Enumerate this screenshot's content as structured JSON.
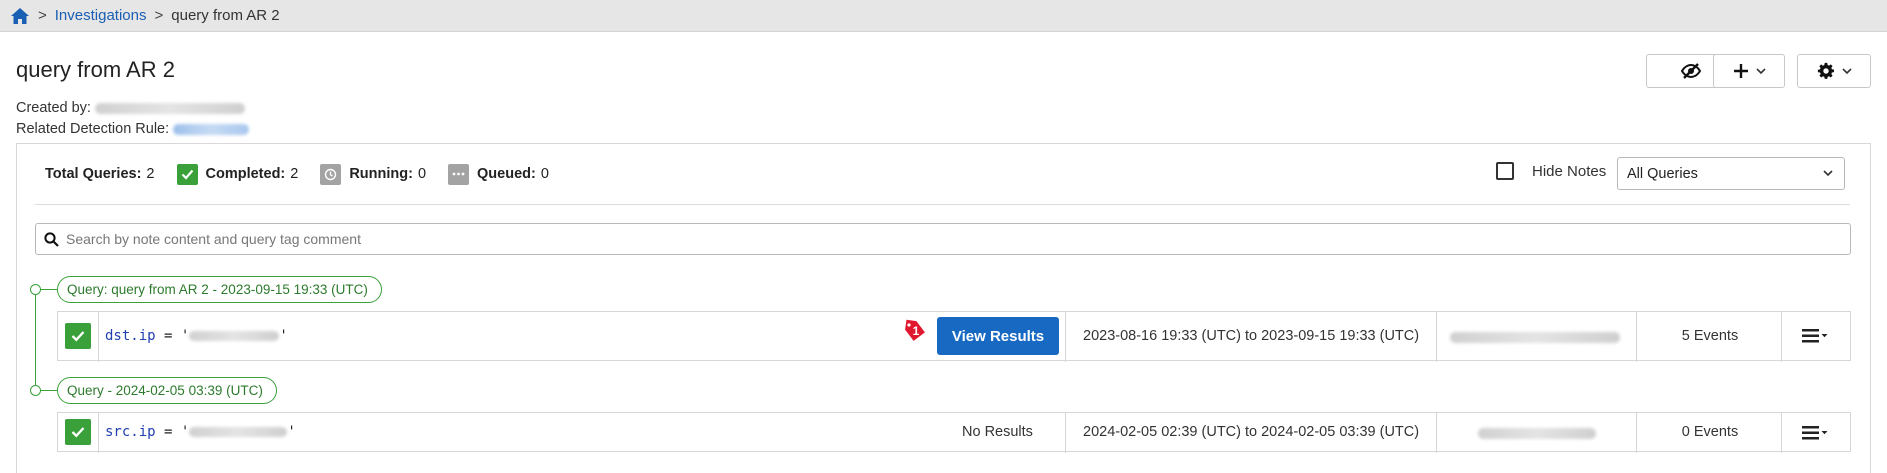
{
  "breadcrumb": {
    "home_icon": "home-icon",
    "separator": ">",
    "items": [
      {
        "label": "Investigations",
        "link": true
      },
      {
        "label": "query from AR 2",
        "link": false
      }
    ]
  },
  "header": {
    "title": "query from AR 2",
    "created_by_label": "Created by:",
    "related_rule_label": "Related Detection Rule:",
    "toolbar": {
      "hide_icon": "eye-slash-icon",
      "add_icon": "plus-icon",
      "settings_icon": "gear-icon"
    }
  },
  "stats": {
    "total_label": "Total Queries:",
    "total_value": "2",
    "completed_label": "Completed:",
    "completed_value": "2",
    "running_label": "Running:",
    "running_value": "0",
    "queued_label": "Queued:",
    "queued_value": "0"
  },
  "filters": {
    "hide_notes_label": "Hide Notes",
    "hide_notes_checked": false,
    "query_filter_value": "All Queries"
  },
  "search": {
    "placeholder": "Search by note content and query tag comment"
  },
  "queries": [
    {
      "label": "Query: query from AR 2 - 2023-09-15 19:33 (UTC)",
      "field": "dst.ip",
      "operator": "= '",
      "closing_quote": "'",
      "notification_count": "1",
      "action_label": "View Results",
      "range": "2023-08-16 19:33 (UTC) to 2023-09-15 19:33 (UTC)",
      "events": "5 Events"
    },
    {
      "label": "Query - 2024-02-05 03:39 (UTC)",
      "field": "src.ip",
      "operator": "= '",
      "closing_quote": "'",
      "action_label": "No Results",
      "range": "2024-02-05 02:39 (UTC) to 2024-02-05 03:39 (UTC)",
      "events": "0 Events"
    }
  ],
  "colors": {
    "accent": "#1769c2",
    "success": "#3aa13a",
    "alert": "#e0182f",
    "muted": "#9e9e9e"
  }
}
